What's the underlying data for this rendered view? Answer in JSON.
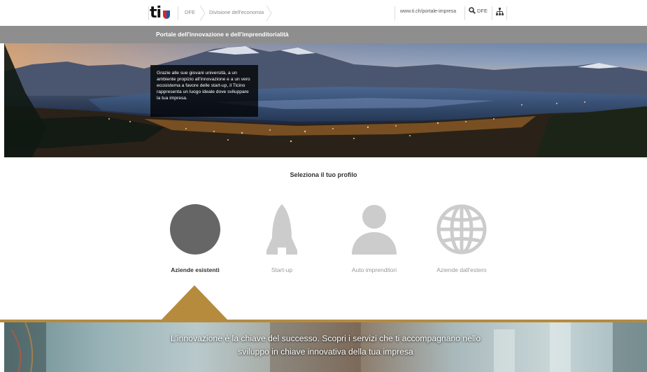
{
  "header": {
    "logo_text": "ti",
    "breadcrumb": [
      "DFE",
      "Divisione dell'economia"
    ],
    "portal_link": "www.ti.ch/portale-impresa",
    "search_label": "DFE"
  },
  "band": {
    "title": "Portale dell'innovazione e dell'imprenditorialità"
  },
  "hero": {
    "text": "Grazie alle sue giovani università, a un ambiente propizio all'innovazione e a un vero ecosistema a favore delle start-up, il Ticino rappresenta un luogo ideale dove sviluppare la tua impresa."
  },
  "profiles": {
    "title": "Seleziona il tuo profilo",
    "items": [
      {
        "label": "Aziende esistenti",
        "icon": "circle-icon",
        "active": true
      },
      {
        "label": "Start-up",
        "icon": "rocket-icon",
        "active": false
      },
      {
        "label": "Auto imprenditori",
        "icon": "person-icon",
        "active": false
      },
      {
        "label": "Aziende dall'estero",
        "icon": "globe-icon",
        "active": false
      }
    ]
  },
  "banner": {
    "line1": "L'innovazione è la chiave del successo. Scopri i servizi che ti accompagnano nello",
    "line2": "sviluppo in chiave innovativa della tua impresa"
  },
  "colors": {
    "accent": "#b68b3e",
    "band": "#8e8e8e",
    "active_icon": "#666666",
    "inactive_icon": "#cccccc"
  }
}
